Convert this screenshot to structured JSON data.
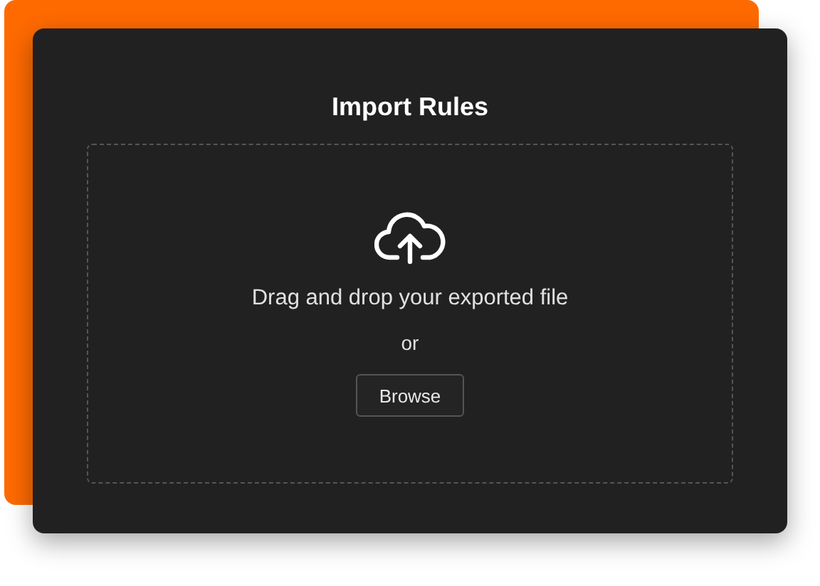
{
  "dialog": {
    "title": "Import Rules"
  },
  "dropzone": {
    "instruction": "Drag and drop your exported file",
    "separator": "or",
    "button": "Browse"
  }
}
